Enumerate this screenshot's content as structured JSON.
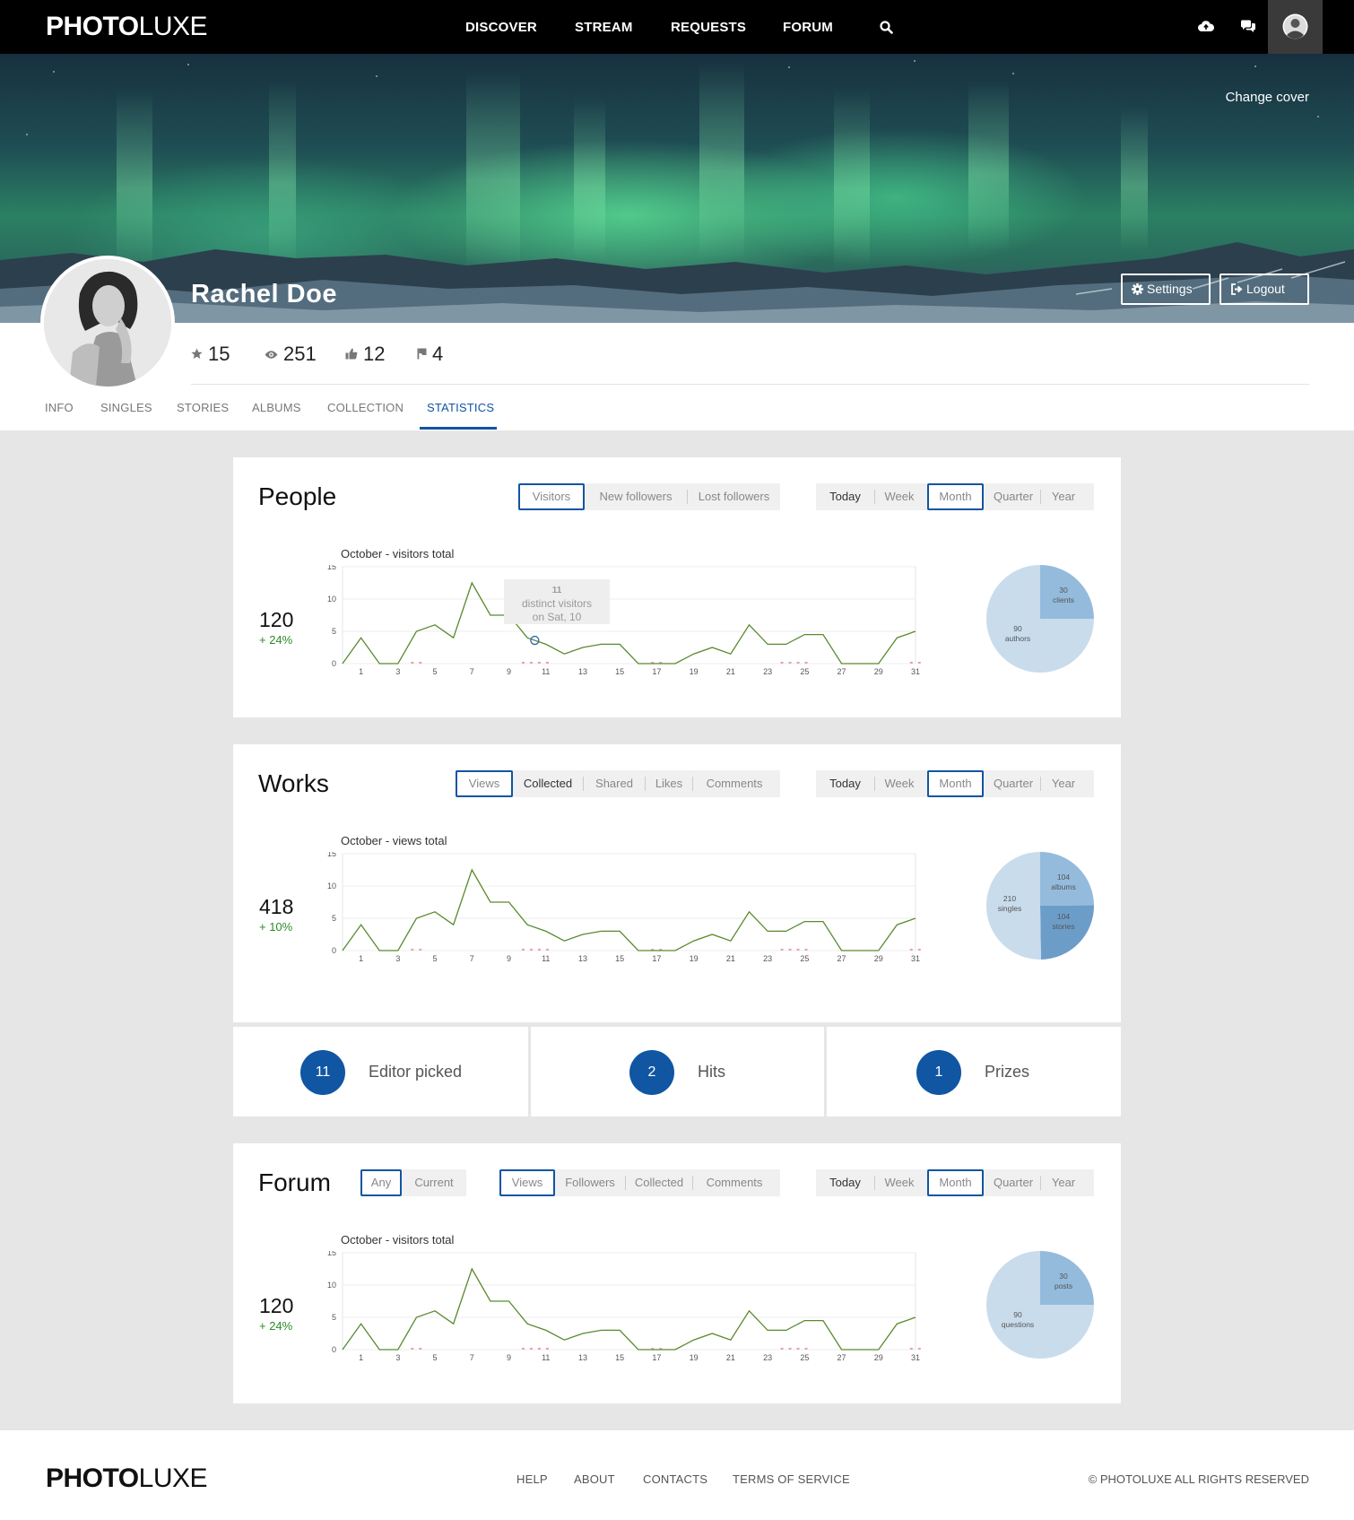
{
  "nav": {
    "logo_bold": "PHOTO",
    "logo_light": "LUXE",
    "links": [
      "DISCOVER",
      "STREAM",
      "REQUESTS",
      "FORUM"
    ],
    "icons": [
      "search-icon",
      "cloud-upload-icon",
      "chat-icon",
      "user-avatar"
    ]
  },
  "cover": {
    "change_cover": "Change cover",
    "settings": "Settings",
    "logout": "Logout"
  },
  "profile": {
    "name": "Rachel Doe",
    "stats": [
      {
        "icon": "star-icon",
        "value": "15"
      },
      {
        "icon": "eye-icon",
        "value": "251"
      },
      {
        "icon": "thumbs-up-icon",
        "value": "12"
      },
      {
        "icon": "flag-icon",
        "value": "4"
      }
    ]
  },
  "tabs": [
    "INFO",
    "SINGLES",
    "STORIES",
    "ALBUMS",
    "COLLECTION",
    "STATISTICS"
  ],
  "active_tab": "STATISTICS",
  "period_options": [
    "Today",
    "Week",
    "Month",
    "Quarter",
    "Year"
  ],
  "people": {
    "title": "People",
    "filters": [
      "Visitors",
      "New followers",
      "Lost followers"
    ],
    "selected_filter": "Visitors",
    "selected_period": "Month",
    "caption": "October - visitors total",
    "total": "120",
    "change": "+ 24%",
    "tooltip": {
      "value": "11",
      "line1": "distinct visitors",
      "line2": "on Sat, 10"
    },
    "pie": [
      {
        "label": "clients",
        "value": 30
      },
      {
        "label": "authors",
        "value": 90
      }
    ]
  },
  "works": {
    "title": "Works",
    "filters": [
      "Views",
      "Collected",
      "Shared",
      "Likes",
      "Comments"
    ],
    "selected_filter": "Views",
    "selected_period": "Month",
    "caption": "October - views total",
    "total": "418",
    "change": "+ 10%",
    "pie": [
      {
        "label": "albums",
        "value": 104
      },
      {
        "label": "stories",
        "value": 104
      },
      {
        "label": "singles",
        "value": 210
      }
    ]
  },
  "badges": [
    {
      "count": "11",
      "label": "Editor picked"
    },
    {
      "count": "2",
      "label": "Hits"
    },
    {
      "count": "1",
      "label": "Prizes"
    }
  ],
  "forum": {
    "title": "Forum",
    "scope": [
      "Any",
      "Current"
    ],
    "selected_scope": "Any",
    "filters": [
      "Views",
      "Followers",
      "Collected",
      "Comments"
    ],
    "selected_filter": "Views",
    "selected_period": "Month",
    "caption": "October - visitors total",
    "total": "120",
    "change": "+ 24%",
    "pie": [
      {
        "label": "posts",
        "value": 30
      },
      {
        "label": "questions",
        "value": 90
      }
    ]
  },
  "chart_data": [
    {
      "type": "line",
      "title": "October - visitors total",
      "x": [
        1,
        2,
        3,
        4,
        5,
        6,
        7,
        8,
        9,
        10,
        11,
        12,
        13,
        14,
        15,
        16,
        17,
        18,
        19,
        20,
        21,
        22,
        23,
        24,
        25,
        26,
        27,
        28,
        29,
        30,
        31
      ],
      "x_ticks": [
        "1",
        "3",
        "5",
        "7",
        "9",
        "11",
        "13",
        "15",
        "17",
        "19",
        "21",
        "23",
        "25",
        "27",
        "29",
        "31"
      ],
      "y_ticks": [
        "0",
        "5",
        "10",
        "15"
      ],
      "ylim": [
        0,
        15
      ],
      "color": "#5a8a2e",
      "weekend_marker_color": "#e7a0ae",
      "series": [
        {
          "values": [
            0,
            4,
            0,
            0,
            5,
            6,
            4,
            12.5,
            7.5,
            7.5,
            4,
            3,
            1.5,
            2.5,
            3,
            3,
            0,
            0,
            0,
            1.5,
            2.5,
            1.5,
            6,
            3,
            3,
            4.5,
            4.5,
            0,
            0,
            0,
            4,
            5
          ]
        }
      ]
    },
    {
      "type": "line",
      "title": "October - views total",
      "x": [
        1,
        2,
        3,
        4,
        5,
        6,
        7,
        8,
        9,
        10,
        11,
        12,
        13,
        14,
        15,
        16,
        17,
        18,
        19,
        20,
        21,
        22,
        23,
        24,
        25,
        26,
        27,
        28,
        29,
        30,
        31
      ],
      "x_ticks": [
        "1",
        "3",
        "5",
        "7",
        "9",
        "11",
        "13",
        "15",
        "17",
        "19",
        "21",
        "23",
        "25",
        "27",
        "29",
        "31"
      ],
      "y_ticks": [
        "0",
        "5",
        "10",
        "15"
      ],
      "ylim": [
        0,
        15
      ],
      "color": "#5a8a2e",
      "series": [
        {
          "values": [
            0,
            4,
            0,
            0,
            5,
            6,
            4,
            12.5,
            7.5,
            7.5,
            4,
            3,
            1.5,
            2.5,
            3,
            3,
            0,
            0,
            0,
            1.5,
            2.5,
            1.5,
            6,
            3,
            3,
            4.5,
            4.5,
            0,
            0,
            0,
            4,
            5
          ]
        }
      ]
    },
    {
      "type": "line",
      "title": "October - visitors total",
      "x": [
        1,
        2,
        3,
        4,
        5,
        6,
        7,
        8,
        9,
        10,
        11,
        12,
        13,
        14,
        15,
        16,
        17,
        18,
        19,
        20,
        21,
        22,
        23,
        24,
        25,
        26,
        27,
        28,
        29,
        30,
        31
      ],
      "x_ticks": [
        "1",
        "3",
        "5",
        "7",
        "9",
        "11",
        "13",
        "15",
        "17",
        "19",
        "21",
        "23",
        "25",
        "27",
        "29",
        "31"
      ],
      "y_ticks": [
        "0",
        "5",
        "10",
        "15"
      ],
      "ylim": [
        0,
        15
      ],
      "color": "#5a8a2e",
      "series": [
        {
          "values": [
            0,
            4,
            0,
            0,
            5,
            6,
            4,
            12.5,
            7.5,
            7.5,
            4,
            3,
            1.5,
            2.5,
            3,
            3,
            0,
            0,
            0,
            1.5,
            2.5,
            1.5,
            6,
            3,
            3,
            4.5,
            4.5,
            0,
            0,
            0,
            4,
            5
          ]
        }
      ]
    },
    {
      "type": "pie",
      "slices": [
        {
          "label": "clients",
          "value": 30
        },
        {
          "label": "authors",
          "value": 90
        }
      ]
    },
    {
      "type": "pie",
      "slices": [
        {
          "label": "albums",
          "value": 104
        },
        {
          "label": "stories",
          "value": 104
        },
        {
          "label": "singles",
          "value": 210
        }
      ]
    },
    {
      "type": "pie",
      "slices": [
        {
          "label": "posts",
          "value": 30
        },
        {
          "label": "questions",
          "value": 90
        }
      ]
    }
  ],
  "footer": {
    "logo_bold": "PHOTO",
    "logo_light": "LUXE",
    "links": [
      "HELP",
      "ABOUT",
      "CONTACTS",
      "TERMS OF SERVICE"
    ],
    "copyright": "© PHOTOLUXE ALL RIGHTS  RESERVED"
  }
}
